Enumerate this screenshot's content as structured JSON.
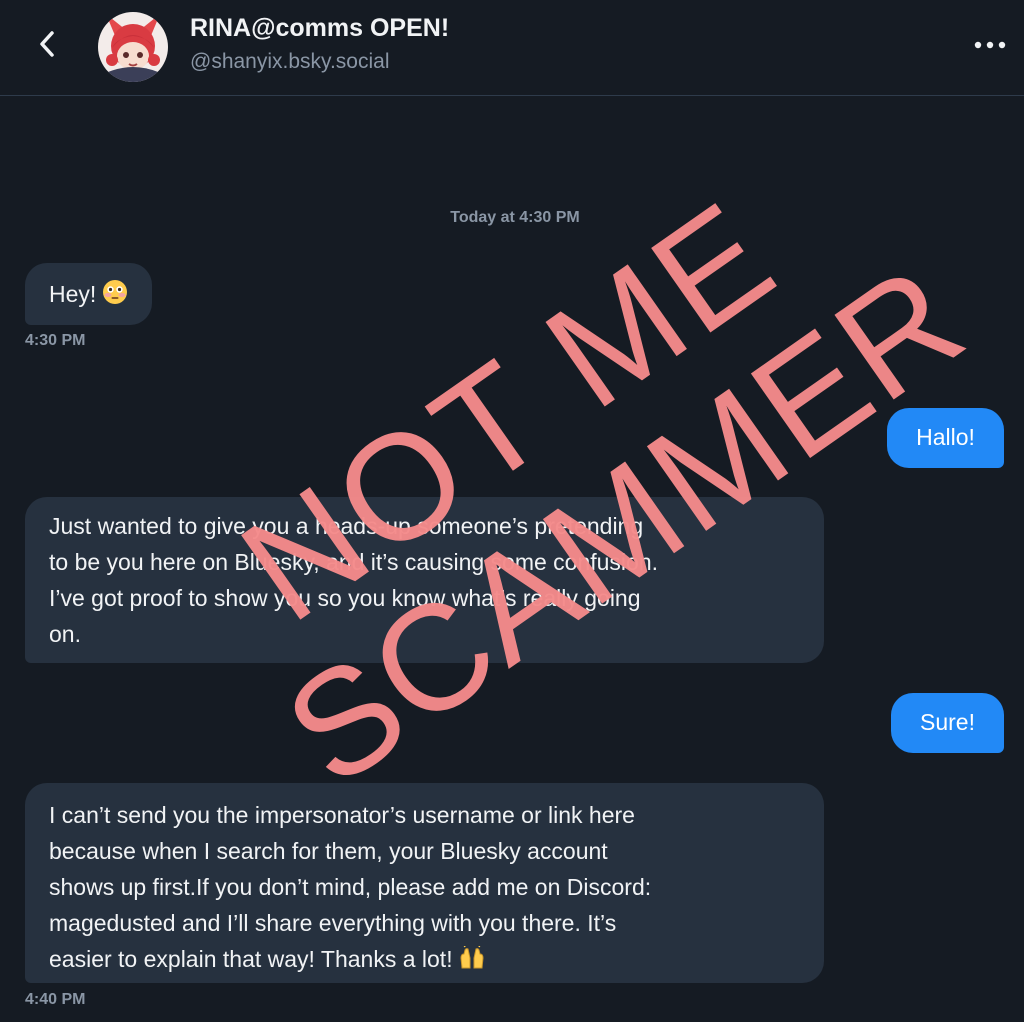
{
  "header": {
    "title": "RINA@comms OPEN!",
    "handle": "@shanyix.bsky.social"
  },
  "conversation": {
    "day_separator": "Today at 4:30 PM",
    "messages": [
      {
        "direction": "received",
        "text": "Hey!",
        "emoji": "flushed-face",
        "time": "4:30 PM"
      },
      {
        "direction": "sent",
        "text": "Hallo!"
      },
      {
        "direction": "received",
        "lines": [
          "Just wanted to give you a heads-up someone’s pretending",
          "to be you here on Bluesky, and it’s causing some confusion.",
          "I’ve got proof to show you so you know what’s really going",
          "on."
        ]
      },
      {
        "direction": "sent",
        "text": "Sure!"
      },
      {
        "direction": "received",
        "lines": [
          "I can’t send you the impersonator’s username or link here",
          "because when I search for them, your Bluesky account",
          "shows up first.If you don’t mind, please add me on Discord:",
          "magedusted and I’ll share everything with you there. It’s",
          "easier to explain that way! Thanks a lot!"
        ],
        "emoji": "raising-hands",
        "time": "4:40 PM"
      }
    ]
  },
  "overlay": {
    "line1": "NOT ME",
    "line2": "SCAMMER",
    "color": "#f48a8a"
  },
  "colors": {
    "background": "#151b23",
    "received_bubble": "#26313f",
    "sent_bubble": "#2289f6",
    "muted_text": "#8a96a5"
  }
}
